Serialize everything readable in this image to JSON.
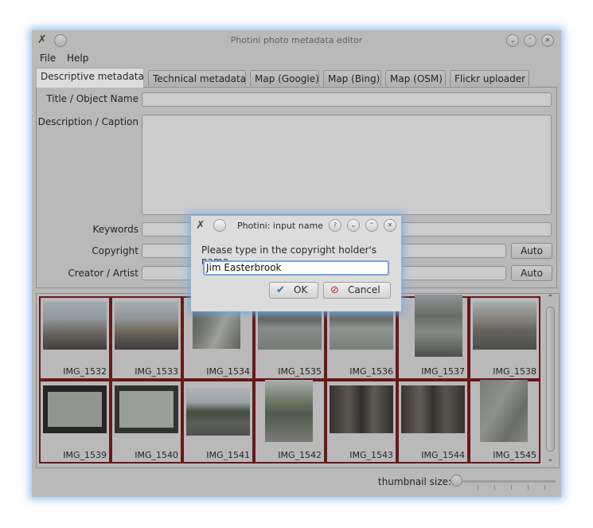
{
  "window": {
    "title": "Photini photo metadata editor"
  },
  "menu": [
    "File",
    "Help"
  ],
  "tabs": [
    {
      "label": "Descriptive metadata",
      "active": true
    },
    {
      "label": "Technical metadata",
      "active": false
    },
    {
      "label": "Map (Google)",
      "active": false
    },
    {
      "label": "Map (Bing)",
      "active": false
    },
    {
      "label": "Map (OSM)",
      "active": false
    },
    {
      "label": "Flickr uploader",
      "active": false
    }
  ],
  "form": {
    "title_label": "Title / Object Name",
    "description_label": "Description / Caption",
    "keywords_label": "Keywords",
    "copyright_label": "Copyright",
    "creator_label": "Creator / Artist",
    "auto_label": "Auto"
  },
  "thumbnails": [
    "IMG_1532",
    "IMG_1533",
    "IMG_1534",
    "IMG_1535",
    "IMG_1536",
    "IMG_1537",
    "IMG_1538",
    "IMG_1539",
    "IMG_1540",
    "IMG_1541",
    "IMG_1542",
    "IMG_1543",
    "IMG_1544",
    "IMG_1545"
  ],
  "thumbnail_size_label": "thumbnail size:",
  "dialog": {
    "title": "Photini: input name",
    "prompt": "Please type in the copyright holder's name",
    "value": "Jim Easterbrook",
    "ok_label": "OK",
    "cancel_label": "Cancel"
  },
  "colors": {
    "selection_border": "#7a1e1e",
    "focus_glow": "#6ea8dd",
    "background": "#d8d8d8"
  }
}
